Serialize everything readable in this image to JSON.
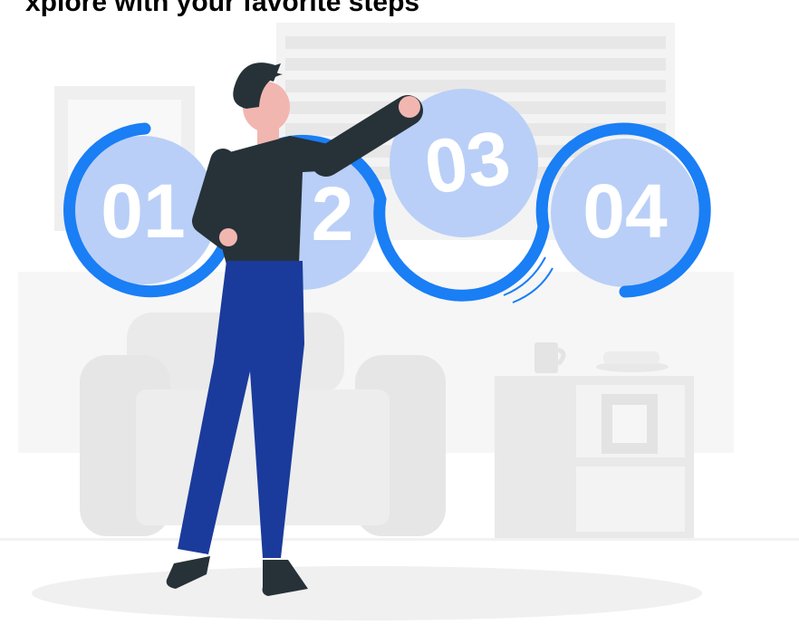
{
  "header": {
    "text": "xplore with your favorite steps",
    "text_color": "#000000"
  },
  "steps": [
    {
      "label": "01",
      "circle_color": "#b9cff7"
    },
    {
      "label": "2",
      "circle_color": "#b9cff7"
    },
    {
      "label": "03",
      "circle_color": "#b9cff7"
    },
    {
      "label": "04",
      "circle_color": "#b9cff7"
    }
  ],
  "colors": {
    "accent_blue": "#1a7ef5",
    "person_shirt": "#263238",
    "person_pants": "#1a3b9c",
    "background_furniture": "#ececec"
  },
  "icons": [
    "person-figure",
    "sofa-icon",
    "shelf-icon",
    "window-icon",
    "mug-icon",
    "picture-frame-icon"
  ]
}
